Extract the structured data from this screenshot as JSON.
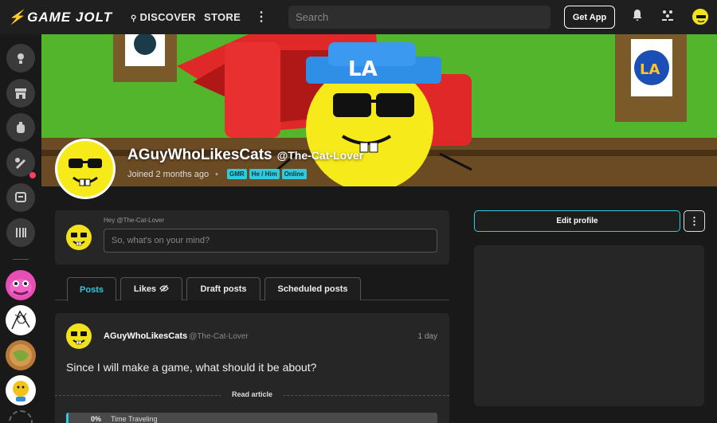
{
  "topbar": {
    "logo_text": "GAME JOLT",
    "nav": {
      "discover": "DISCOVER",
      "store": "STORE"
    },
    "search_placeholder": "Search",
    "get_app": "Get App"
  },
  "profile": {
    "display_name": "AGuyWhoLikesCats",
    "username": "@The-Cat-Lover",
    "joined": "Joined 2 months ago",
    "badges": [
      "GMR",
      "He / Him",
      "Online"
    ]
  },
  "composer": {
    "greeting": "Hey @The-Cat-Lover",
    "placeholder": "So, what's on your mind?"
  },
  "tabs": [
    {
      "label": "Posts",
      "active": true
    },
    {
      "label": "Likes"
    },
    {
      "label": "Draft posts"
    },
    {
      "label": "Scheduled posts"
    }
  ],
  "post": {
    "author": "AGuyWhoLikesCats",
    "handle": "@The-Cat-Lover",
    "time": "1 day",
    "body": "Since I will make a game, what should it be about?",
    "read_article": "Read article",
    "poll": {
      "percent_label": "0%",
      "percent": 0,
      "option": "Time Traveling"
    }
  },
  "right": {
    "edit_profile": "Edit profile",
    "more": "⋮"
  },
  "colors": {
    "accent": "#2ecbe0",
    "notify": "#ff3e60",
    "avatar_yellow": "#f2e21c"
  }
}
